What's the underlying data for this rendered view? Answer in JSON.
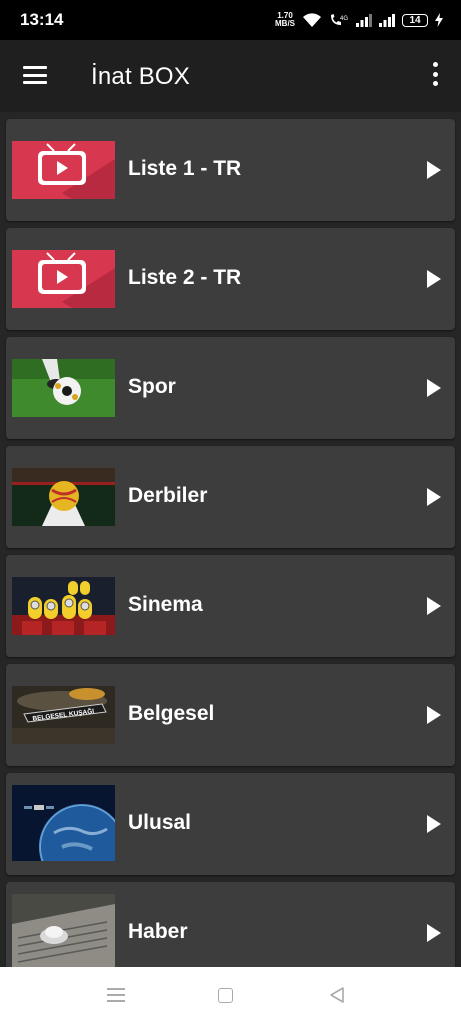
{
  "status": {
    "time": "13:14",
    "speed_value": "1.70",
    "speed_unit": "MB/S",
    "battery": "14"
  },
  "app": {
    "title": "İnat BOX"
  },
  "items": [
    {
      "label": "Liste 1 - TR",
      "thumb": "tv-icon"
    },
    {
      "label": "Liste 2 - TR",
      "thumb": "tv-icon"
    },
    {
      "label": "Spor",
      "thumb": "soccer-ball"
    },
    {
      "label": "Derbiler",
      "thumb": "stadium-ball"
    },
    {
      "label": "Sinema",
      "thumb": "minions-cinema"
    },
    {
      "label": "Belgesel",
      "thumb": "belgesel-kusagi"
    },
    {
      "label": "Ulusal",
      "thumb": "earth-satellite"
    },
    {
      "label": "Haber",
      "thumb": "newspaper-globe"
    }
  ],
  "thumb_texts": {
    "belgesel": "BELGESEL KUŞAĞI"
  },
  "colors": {
    "accent_red": "#d8384f",
    "card": "#3d3d3d",
    "app_bar": "#1f1f1f"
  }
}
